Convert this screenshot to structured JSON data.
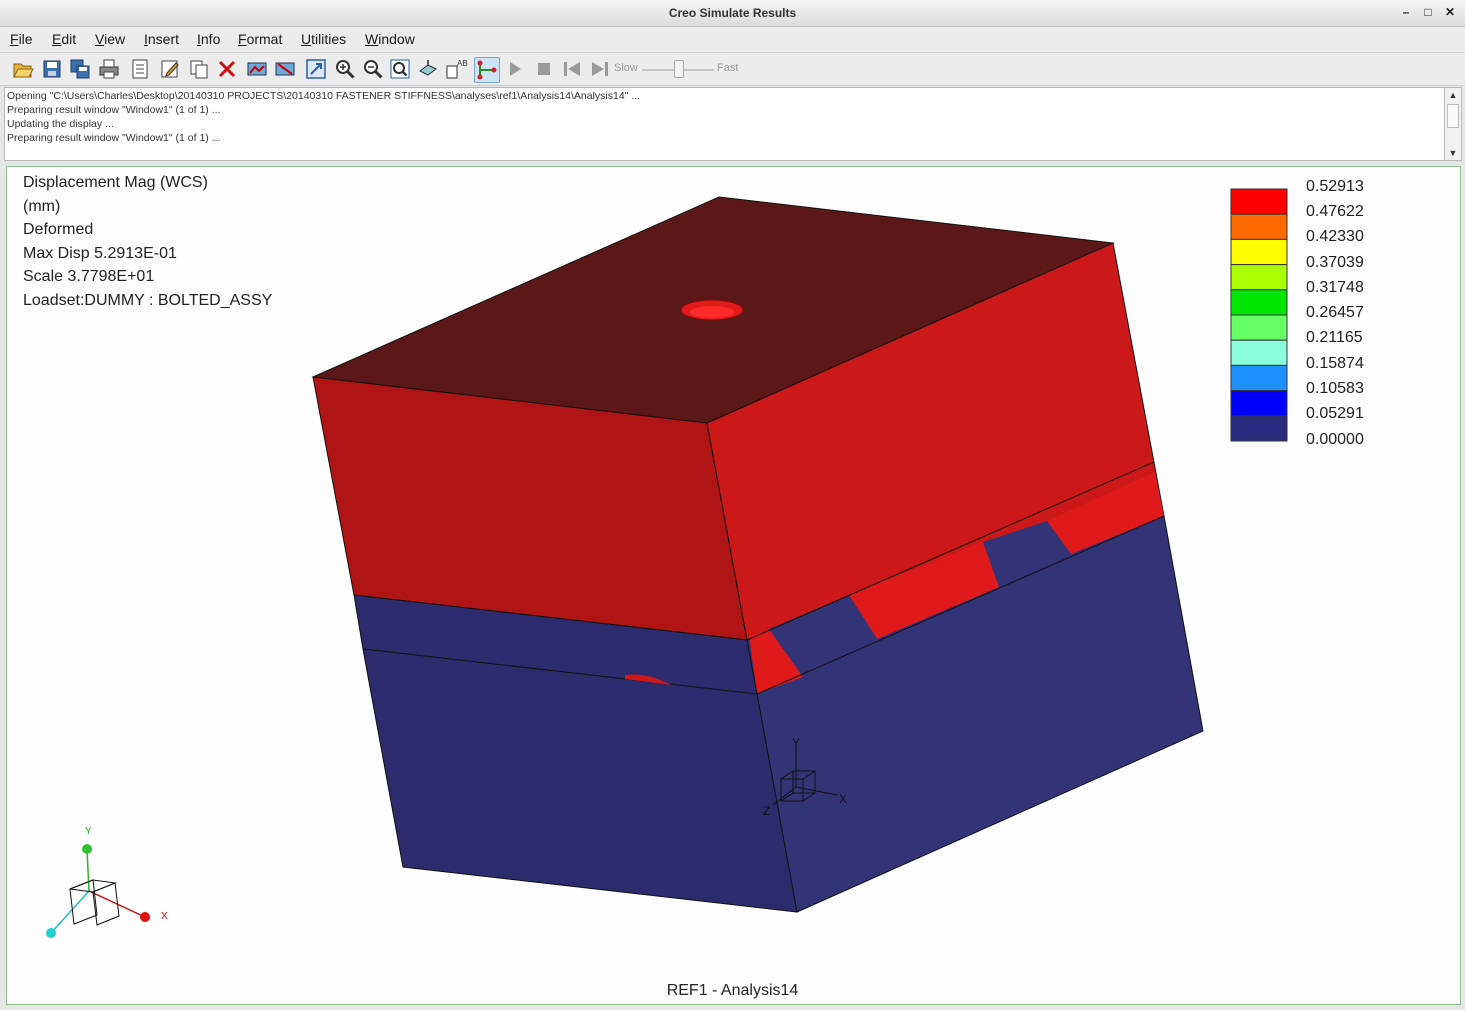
{
  "window": {
    "title": "Creo Simulate Results",
    "minimize": "–",
    "maximize": "□",
    "close": "✕"
  },
  "menu": [
    "File",
    "Edit",
    "View",
    "Insert",
    "Info",
    "Format",
    "Utilities",
    "Window"
  ],
  "toolbar": {
    "icons": [
      "open-icon",
      "save-icon",
      "save-all-icon",
      "print-icon",
      "report-icon",
      "edit-definition-icon",
      "copy-icon",
      "delete-icon",
      "show-icon",
      "hide-icon",
      "refit-icon",
      "zoom-in-icon",
      "zoom-out-icon",
      "zoom-window-icon",
      "orient-icon",
      "label-icon",
      "query-icon",
      "play-icon",
      "stop-icon",
      "first-frame-icon",
      "last-frame-icon"
    ],
    "speed_slow": "Slow",
    "speed_fast": "Fast"
  },
  "messages": [
    "Opening \"C:\\Users\\Charles\\Desktop\\20140310 PROJECTS\\20140310 FASTENER STIFFNESS\\analyses\\ref1\\Analysis14\\Analysis14\" ...",
    "Preparing result window \"Window1\" (1 of 1) ...",
    "Updating the display ...",
    "Preparing result window \"Window1\" (1 of 1) ..."
  ],
  "result_info": {
    "line1": "Displacement Mag (WCS)",
    "line2": "(mm)",
    "line3": "Deformed",
    "line4": "Max Disp  5.2913E-01",
    "line5": "Scale  3.7798E+01",
    "line6": "Loadset:DUMMY :  BOLTED_ASSY"
  },
  "legend": {
    "values": [
      "0.52913",
      "0.47622",
      "0.42330",
      "0.37039",
      "0.31748",
      "0.26457",
      "0.21165",
      "0.15874",
      "0.10583",
      "0.05291",
      "0.00000"
    ],
    "colors": [
      "#ff0000",
      "#ff6a00",
      "#ffff00",
      "#aaff00",
      "#00e600",
      "#66ff66",
      "#88ffdd",
      "#1e90ff",
      "#0000ff",
      "#2b2b80"
    ]
  },
  "model_colors": {
    "top_face": "#5c1818",
    "red_front": "#b01414",
    "red_right": "#cc1818",
    "blue_front": "#2b2b6e",
    "blue_right": "#333377"
  },
  "axes": {
    "x": "X",
    "y": "Y",
    "z": "Z"
  },
  "caption": "REF1 - Analysis14"
}
